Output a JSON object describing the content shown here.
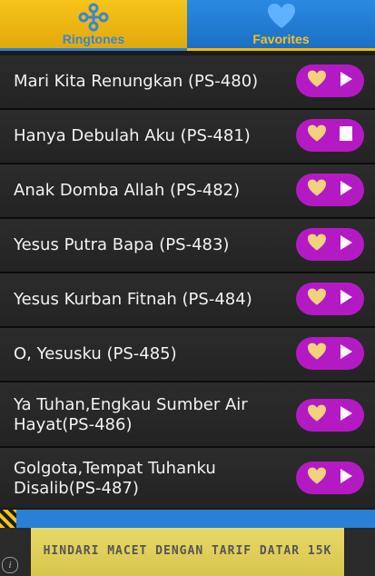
{
  "tabs": {
    "ringtones": {
      "label": "Ringtones",
      "icon": "cross-icon"
    },
    "favorites": {
      "label": "Favorites",
      "icon": "heart-icon"
    }
  },
  "list": {
    "items": [
      {
        "title": "Mari Kita Renungkan (PS-480)",
        "play_state": "play"
      },
      {
        "title": "Hanya Debulah Aku (PS-481)",
        "play_state": "stop"
      },
      {
        "title": "Anak Domba Allah (PS-482)",
        "play_state": "play"
      },
      {
        "title": "Yesus Putra Bapa (PS-483)",
        "play_state": "play"
      },
      {
        "title": "Yesus Kurban Fitnah (PS-484)",
        "play_state": "play"
      },
      {
        "title": "O, Yesusku (PS-485)",
        "play_state": "play"
      },
      {
        "title": "Ya Tuhan,Engkau Sumber Air Hayat(PS-486)",
        "play_state": "play"
      },
      {
        "title": "Golgota,Tempat Tuhanku Disalib(PS-487)",
        "play_state": "play"
      }
    ]
  },
  "ad": {
    "text": "HINDARI MACET DENGAN TARIF DATAR 15K",
    "info_icon": "info-icon"
  },
  "colors": {
    "tab_ringtones_bg": "#f2b800",
    "tab_favorites_bg": "#2a8ae0",
    "pill_bg": "#b41ac4",
    "heart": "#f3d27a",
    "row_bg": "#262626"
  }
}
